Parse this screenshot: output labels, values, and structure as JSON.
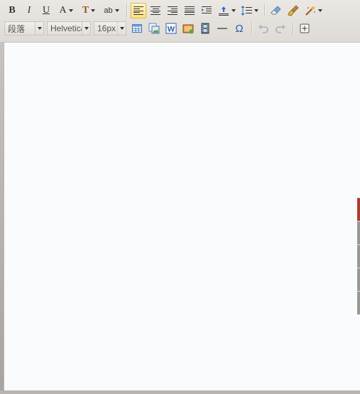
{
  "toolbar": {
    "bold_label": "B",
    "italic_label": "I",
    "underline_label": "U",
    "forecolor_label": "A",
    "backcolor_label": "T",
    "casing_label": "ab",
    "paragraph_select": "段落",
    "font_family_select": "Helvetica",
    "font_size_select": "16px",
    "special_char_label": "Ω",
    "accent_color": "#e0b84a"
  },
  "colors": {
    "toolbar_bg": "#e6e2dd",
    "content_bg": "#fafbfd",
    "side_tab_active": "#b23a30",
    "side_tab": "#9a9895"
  }
}
